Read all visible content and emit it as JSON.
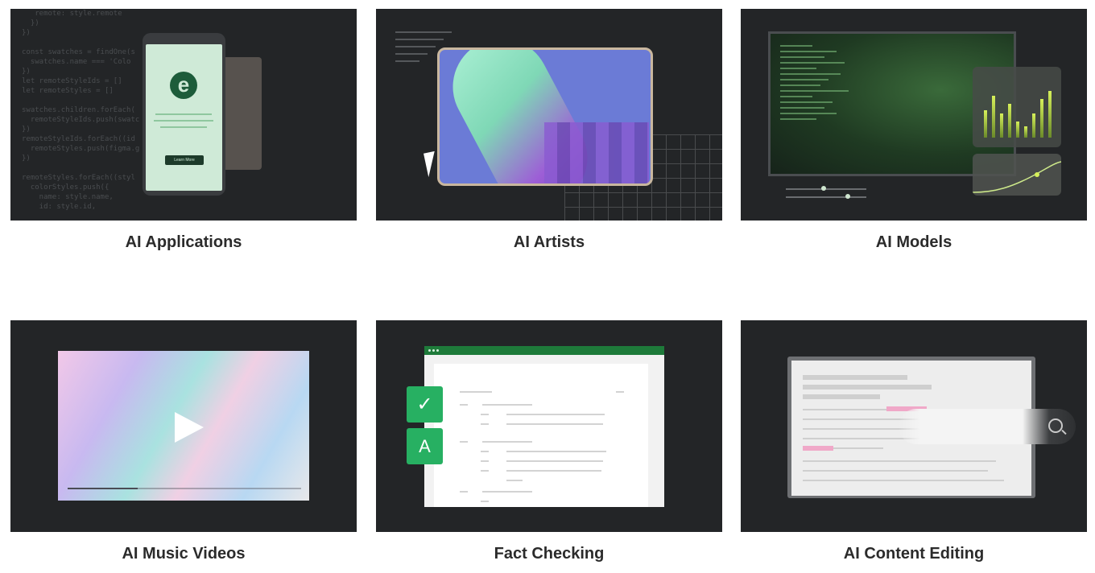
{
  "cards": [
    {
      "label": "AI Applications",
      "phone_button": "Learn More",
      "code_lines": [
        "   remote: style.remote",
        "  })",
        "})",
        "",
        "const swatches = findOne(s",
        "  swatches.name === 'Colo",
        "})",
        "let remoteStyleIds = []",
        "let remoteStyles = []",
        "",
        "swatches.children.forEach(",
        "  remoteStyleIds.push(swatc",
        "})",
        "remoteStyleIds.forEach((id",
        "  remoteStyles.push(figma.g",
        "})",
        "",
        "remoteStyles.forEach((styl",
        "  colorStyles.push({",
        "    name: style.name,",
        "    id: style.id,"
      ]
    },
    {
      "label": "AI Artists"
    },
    {
      "label": "AI Models"
    },
    {
      "label": "AI Music Videos",
      "progress": 0.3
    },
    {
      "label": "Fact Checking"
    },
    {
      "label": "AI Content Editing"
    }
  ],
  "colors": {
    "accent_green": "#27b062",
    "dark_bg": "#232527",
    "label_text": "#2b2b2b"
  }
}
